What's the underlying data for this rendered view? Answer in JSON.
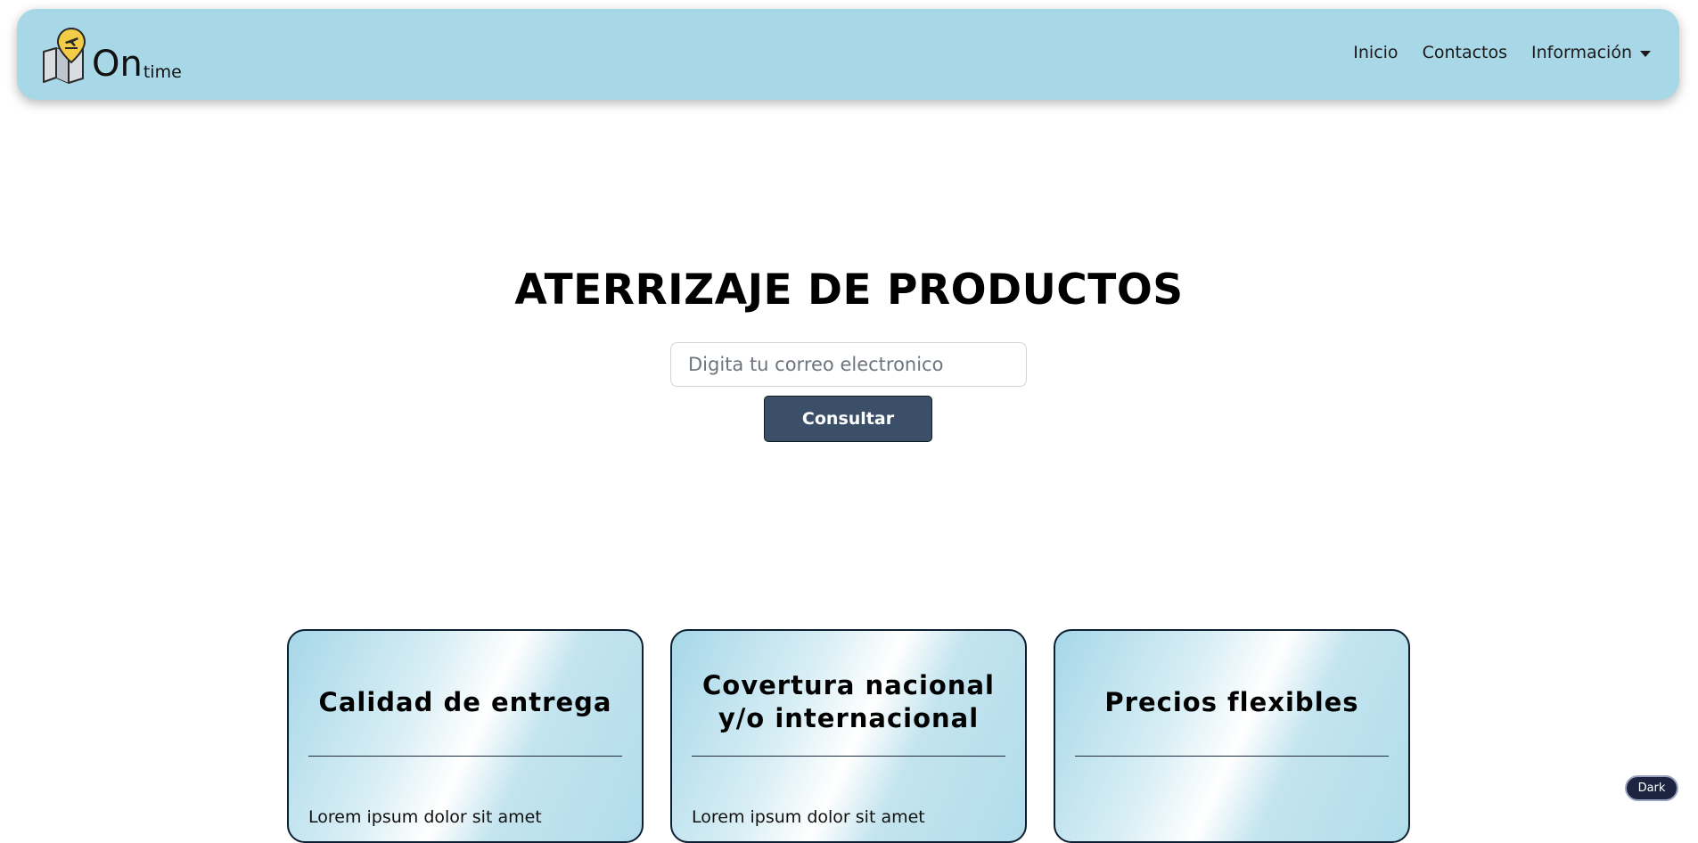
{
  "brand": {
    "name_main": "On",
    "name_sub": "time",
    "logo_icon": "map-pin-plane-icon"
  },
  "nav": {
    "items": [
      {
        "label": "Inicio"
      },
      {
        "label": "Contactos"
      },
      {
        "label": "Información"
      }
    ]
  },
  "hero": {
    "title": "ATERRIZAJE DE PRODUCTOS",
    "email_placeholder": "Digita tu correo electronico",
    "email_value": "",
    "button_label": "Consultar"
  },
  "cards": [
    {
      "title": "Calidad de entrega",
      "text": "Lorem ipsum dolor sit amet"
    },
    {
      "title": "Covertura nacional y/o internacional",
      "text": "Lorem ipsum dolor sit amet"
    },
    {
      "title": "Precios flexibles",
      "text": ""
    }
  ],
  "theme_toggle": {
    "label": "Dark"
  },
  "colors": {
    "navbar_bg": "#a8d8e8",
    "button_bg": "#3b5068",
    "toggle_bg": "#1c2440"
  }
}
